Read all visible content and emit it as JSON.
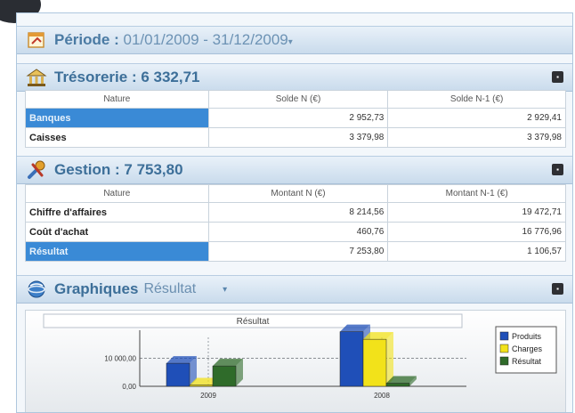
{
  "periode": {
    "label": "Période :",
    "value": "01/01/2009 - 31/12/2009",
    "arrow": "▾"
  },
  "tresorerie": {
    "title": "Trésorerie : 6 332,71",
    "columns": [
      "Nature",
      "Solde N (€)",
      "Solde N-1 (€)"
    ],
    "rows": [
      {
        "nature": "Banques",
        "n": "2 952,73",
        "n1": "2 929,41"
      },
      {
        "nature": "Caisses",
        "n": "3 379,98",
        "n1": "3 379,98"
      }
    ]
  },
  "gestion": {
    "title": "Gestion : 7 753,80",
    "columns": [
      "Nature",
      "Montant N (€)",
      "Montant N-1 (€)"
    ],
    "rows": [
      {
        "nature": "Chiffre d'affaires",
        "n": "8 214,56",
        "n1": "19 472,71"
      },
      {
        "nature": "Coût d'achat",
        "n": "460,76",
        "n1": "16 776,96"
      },
      {
        "nature": "Résultat",
        "n": "7 253,80",
        "n1": "1 106,57"
      }
    ]
  },
  "graphiques": {
    "title": "Graphiques",
    "selected": "Résultat",
    "arrow": "▾"
  },
  "chart_data": {
    "type": "bar",
    "title": "Résultat",
    "categories": [
      "2009",
      "2008"
    ],
    "series": [
      {
        "name": "Produits",
        "color": "#1f4fb8",
        "values": [
          8214.56,
          19472.71
        ]
      },
      {
        "name": "Charges",
        "color": "#f2e21a",
        "values": [
          460.76,
          16776.96
        ]
      },
      {
        "name": "Résultat",
        "color": "#2f6b2a",
        "values": [
          7253.8,
          1106.57
        ]
      }
    ],
    "yticks": [
      "0,00",
      "10 000,00"
    ],
    "ylim": [
      0,
      20000
    ],
    "legend": "right"
  },
  "icons": {
    "periode": "calendar-icon",
    "tresorerie": "bank-icon",
    "gestion": "tools-icon",
    "graphiques": "globe-icon",
    "collapse": "collapse-icon"
  }
}
